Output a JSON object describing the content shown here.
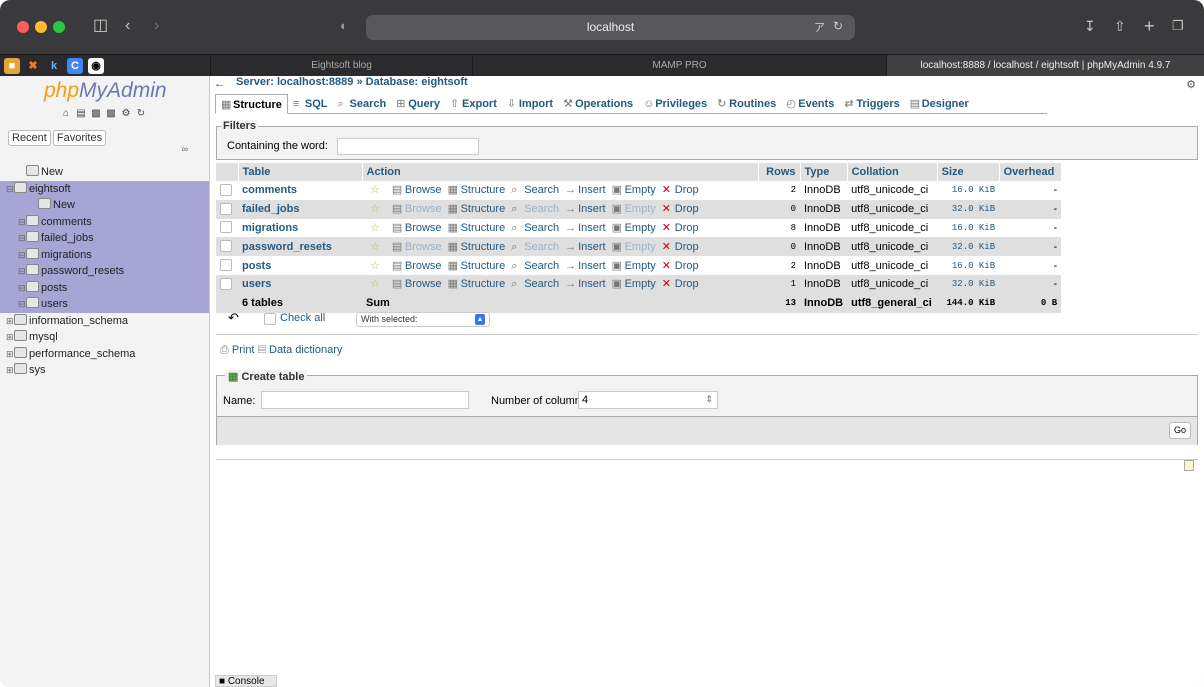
{
  "browser": {
    "url": "localhost",
    "tabs": [
      {
        "label": "Eightsoft blog"
      },
      {
        "label": "MAMP PRO"
      },
      {
        "label": "localhost:8888 / localhost / eightsoft | phpMyAdmin 4.9.7"
      }
    ]
  },
  "sidebar": {
    "logo_php": "php",
    "logo_myadmin": "MyAdmin",
    "recent": "Recent",
    "favorites": "Favorites",
    "tree": [
      {
        "label": "New",
        "indent": 1,
        "sel": false
      },
      {
        "label": "eightsoft",
        "indent": 0,
        "sel": true
      },
      {
        "label": "New",
        "indent": 2,
        "sel": true
      },
      {
        "label": "comments",
        "indent": 1,
        "sel": true
      },
      {
        "label": "failed_jobs",
        "indent": 1,
        "sel": true
      },
      {
        "label": "migrations",
        "indent": 1,
        "sel": true
      },
      {
        "label": "password_resets",
        "indent": 1,
        "sel": true
      },
      {
        "label": "posts",
        "indent": 1,
        "sel": true
      },
      {
        "label": "users",
        "indent": 1,
        "sel": true
      },
      {
        "label": "information_schema",
        "indent": 0,
        "sel": false
      },
      {
        "label": "mysql",
        "indent": 0,
        "sel": false
      },
      {
        "label": "performance_schema",
        "indent": 0,
        "sel": false
      },
      {
        "label": "sys",
        "indent": 0,
        "sel": false
      }
    ]
  },
  "breadcrumb": {
    "server": "Server: localhost:8889",
    "sep": "»",
    "database": "Database: eightsoft"
  },
  "tabs": [
    "Structure",
    "SQL",
    "Search",
    "Query",
    "Export",
    "Import",
    "Operations",
    "Privileges",
    "Routines",
    "Events",
    "Triggers",
    "Designer"
  ],
  "filters": {
    "legend": "Filters",
    "label": "Containing the word:"
  },
  "table": {
    "headers": [
      "Table",
      "Action",
      "Rows",
      "Type",
      "Collation",
      "Size",
      "Overhead"
    ],
    "actions": [
      "Browse",
      "Structure",
      "Search",
      "Insert",
      "Empty",
      "Drop"
    ],
    "rows": [
      {
        "name": "comments",
        "rows": "2",
        "type": "InnoDB",
        "collation": "utf8_unicode_ci",
        "size": "16.0 KiB",
        "overhead": "-"
      },
      {
        "name": "failed_jobs",
        "rows": "0",
        "type": "InnoDB",
        "collation": "utf8_unicode_ci",
        "size": "32.0 KiB",
        "overhead": "-"
      },
      {
        "name": "migrations",
        "rows": "8",
        "type": "InnoDB",
        "collation": "utf8_unicode_ci",
        "size": "16.0 KiB",
        "overhead": "-"
      },
      {
        "name": "password_resets",
        "rows": "0",
        "type": "InnoDB",
        "collation": "utf8_unicode_ci",
        "size": "32.0 KiB",
        "overhead": "-"
      },
      {
        "name": "posts",
        "rows": "2",
        "type": "InnoDB",
        "collation": "utf8_unicode_ci",
        "size": "16.0 KiB",
        "overhead": "-"
      },
      {
        "name": "users",
        "rows": "1",
        "type": "InnoDB",
        "collation": "utf8_unicode_ci",
        "size": "32.0 KiB",
        "overhead": "-"
      }
    ],
    "summary": {
      "count": "6 tables",
      "sum": "Sum",
      "rows": "13",
      "type": "InnoDB",
      "collation": "utf8_general_ci",
      "size": "144.0 KiB",
      "overhead": "0 B"
    }
  },
  "check_all": "Check all",
  "with_selected": "With selected:",
  "print": "Print",
  "data_dictionary": "Data dictionary",
  "create": {
    "legend": "Create table",
    "name_label": "Name:",
    "cols_label": "Number of columns:",
    "cols_value": "4",
    "go": "Go"
  },
  "console": "Console"
}
